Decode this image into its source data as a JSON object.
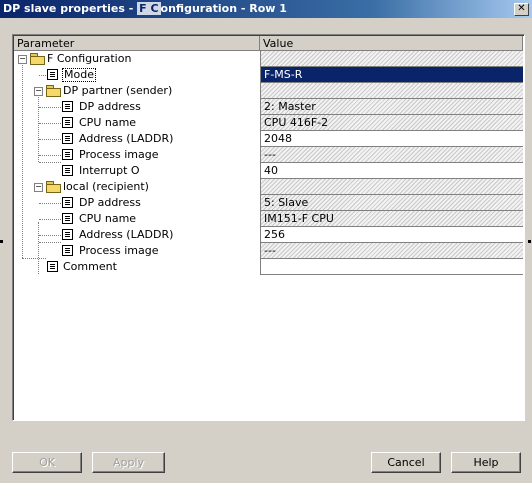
{
  "window": {
    "title_prefix": "DP slave properties - ",
    "title_highlight": "F C",
    "title_suffix": "onfiguration - Row 1",
    "close_glyph": "✕"
  },
  "columns": {
    "param": "Parameter",
    "value": "Value"
  },
  "rows": [
    {
      "label": "F Configuration",
      "value": ""
    },
    {
      "label": "Mode",
      "value": "F-MS-R"
    },
    {
      "label": "DP partner (sender)",
      "value": ""
    },
    {
      "label": "DP address",
      "value": "2: Master"
    },
    {
      "label": "CPU name",
      "value": "CPU 416F-2"
    },
    {
      "label": "Address (LADDR)",
      "value": "2048"
    },
    {
      "label": "Process image",
      "value": "---"
    },
    {
      "label": "Interrupt O",
      "value": "40"
    },
    {
      "label": "local (recipient)",
      "value": ""
    },
    {
      "label": "DP address",
      "value": "5: Slave"
    },
    {
      "label": "CPU name",
      "value": "IM151-F CPU"
    },
    {
      "label": "Address (LADDR)",
      "value": "256"
    },
    {
      "label": "Process image",
      "value": "---"
    },
    {
      "label": "Comment",
      "value": ""
    }
  ],
  "buttons": {
    "ok": "OK",
    "apply": "Apply",
    "cancel": "Cancel",
    "help": "Help"
  },
  "colors": {
    "selection": "#0a246a",
    "dialog": "#d4d0c8",
    "titlebar": "#0a246a"
  },
  "icons": {
    "collapse": "minus-icon",
    "folder": "folder-icon",
    "parameter": "parameter-icon"
  }
}
